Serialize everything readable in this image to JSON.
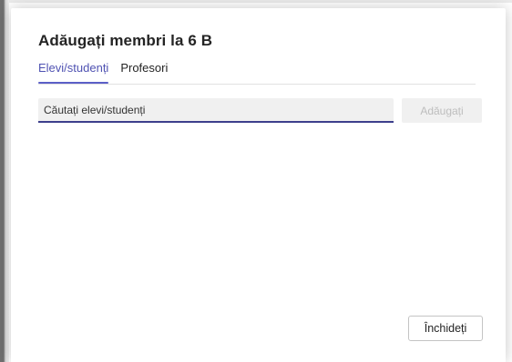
{
  "dialog": {
    "title": "Adăugați membri la 6 B",
    "tabs": [
      {
        "label": "Elevi/studenți",
        "active": true
      },
      {
        "label": "Profesori",
        "active": false
      }
    ],
    "search": {
      "placeholder": "Căutați elevi/studenți",
      "value": ""
    },
    "add_label": "Adăugați",
    "close_label": "Închideți"
  },
  "colors": {
    "accent": "#5b5fc7",
    "search_underline": "#3d3f8c",
    "disabled_text": "#bdbdbd"
  }
}
